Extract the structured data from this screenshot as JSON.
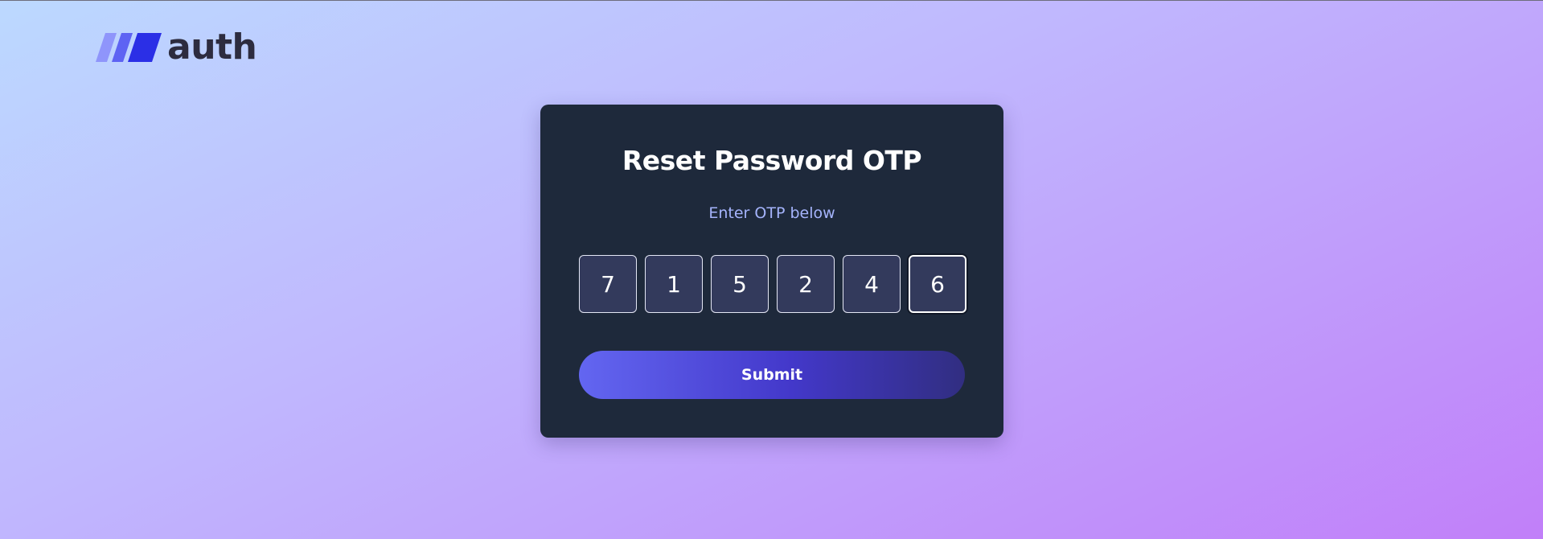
{
  "brand": {
    "name": "auth",
    "icon": "slanted-stripes-logo-icon",
    "colors": [
      "#8f95fb",
      "#5e63f3",
      "#2b2fe6"
    ]
  },
  "card": {
    "title": "Reset Password OTP",
    "subtitle": "Enter OTP below",
    "otp_digits": [
      "7",
      "1",
      "5",
      "2",
      "4",
      "6"
    ],
    "focused_index": 5,
    "submit_label": "Submit"
  },
  "colors": {
    "card_bg": "#1e293b",
    "subtitle": "#a5b4fc",
    "button_start": "#6366f1",
    "button_end": "#312e81"
  }
}
